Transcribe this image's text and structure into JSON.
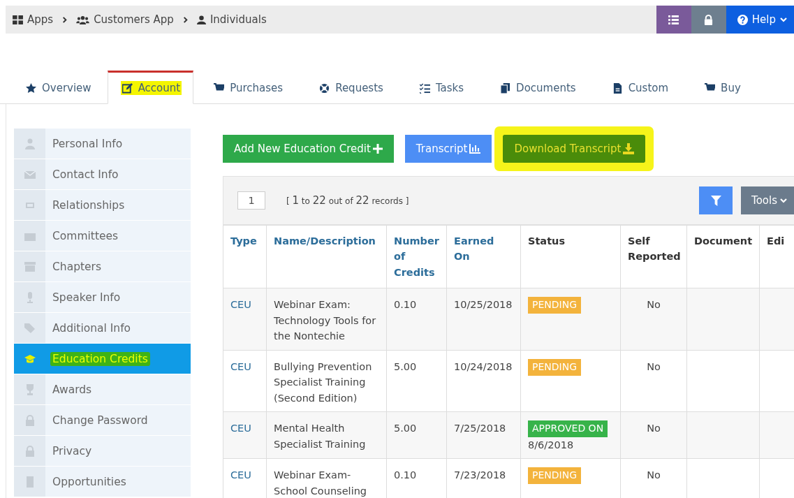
{
  "breadcrumb": [
    "Apps",
    "Customers App",
    "Individuals"
  ],
  "top_buttons": {
    "help": "Help"
  },
  "tabs": [
    {
      "label": "Overview",
      "selected": false,
      "highlighted": false
    },
    {
      "label": "Account",
      "selected": true,
      "highlighted": true
    },
    {
      "label": "Purchases",
      "selected": false,
      "highlighted": false
    },
    {
      "label": "Requests",
      "selected": false,
      "highlighted": false
    },
    {
      "label": "Tasks",
      "selected": false,
      "highlighted": false
    },
    {
      "label": "Documents",
      "selected": false,
      "highlighted": false
    },
    {
      "label": "Custom",
      "selected": false,
      "highlighted": false
    },
    {
      "label": "Buy",
      "selected": false,
      "highlighted": false
    }
  ],
  "sidebar": {
    "items": [
      {
        "label": "Personal Info",
        "selected": false,
        "highlighted": false
      },
      {
        "label": "Contact Info",
        "selected": false,
        "highlighted": false
      },
      {
        "label": "Relationships",
        "selected": false,
        "highlighted": false
      },
      {
        "label": "Committees",
        "selected": false,
        "highlighted": false
      },
      {
        "label": "Chapters",
        "selected": false,
        "highlighted": false
      },
      {
        "label": "Speaker Info",
        "selected": false,
        "highlighted": false
      },
      {
        "label": "Additional Info",
        "selected": false,
        "highlighted": false
      },
      {
        "label": "Education Credits",
        "selected": true,
        "highlighted": true
      },
      {
        "label": "Awards",
        "selected": false,
        "highlighted": false
      },
      {
        "label": "Change Password",
        "selected": false,
        "highlighted": false
      },
      {
        "label": "Privacy",
        "selected": false,
        "highlighted": false
      },
      {
        "label": "Opportunities",
        "selected": false,
        "highlighted": false
      }
    ]
  },
  "actions": [
    {
      "label": "Add New Education Credit",
      "kind": "add",
      "highlighted": false
    },
    {
      "label": "Transcript",
      "kind": "transcript",
      "highlighted": false
    },
    {
      "label": "Download Transcript",
      "kind": "download",
      "highlighted": true
    }
  ],
  "pager": {
    "page": "1",
    "summary": "[ **1** to **22** out of **22** records ]"
  },
  "tools": "Tools",
  "table": {
    "columns": [
      {
        "label": "Type",
        "sortable": true
      },
      {
        "label": "Name/Description",
        "sortable": true
      },
      {
        "label": "Number of Credits",
        "sortable": true
      },
      {
        "label": "Earned On",
        "sortable": true
      },
      {
        "label": "Status",
        "sortable": false
      },
      {
        "label": "Self Reported",
        "sortable": false
      },
      {
        "label": "Document",
        "sortable": false
      },
      {
        "label": "Edi",
        "sortable": false
      }
    ],
    "rows": [
      {
        "type": "CEU",
        "name": "Webinar Exam: Technology Tools for the Nontechie",
        "credits": "0.10",
        "earned_on": "10/25/2018",
        "status": {
          "kind": "pending",
          "label": "PENDING"
        },
        "self_reported": "No"
      },
      {
        "type": "CEU",
        "name": "Bullying Prevention Specialist Training (Second Edition)",
        "credits": "5.00",
        "earned_on": "10/24/2018",
        "status": {
          "kind": "pending",
          "label": "PENDING"
        },
        "self_reported": "No"
      },
      {
        "type": "CEU",
        "name": "Mental Health Specialist Training",
        "credits": "5.00",
        "earned_on": "7/25/2018",
        "status": {
          "kind": "approved",
          "label": "APPROVED ON",
          "date": "8/6/2018"
        },
        "self_reported": "No"
      },
      {
        "type": "CEU",
        "name": "Webinar Exam-School Counseling",
        "credits": "0.10",
        "earned_on": "7/23/2018",
        "status": {
          "kind": "pending",
          "label": "PENDING"
        },
        "self_reported": "No"
      }
    ]
  }
}
